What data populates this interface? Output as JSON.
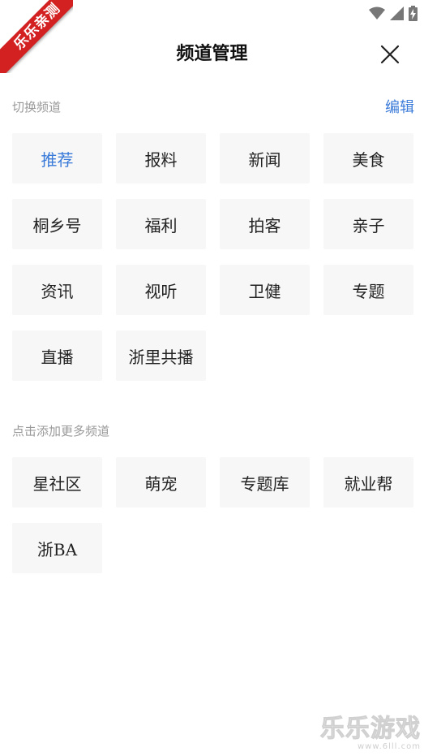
{
  "status_bar": {
    "icons": [
      "wifi-icon",
      "signal-icon",
      "battery-charging-icon"
    ]
  },
  "ribbon": {
    "text": "乐乐亲测"
  },
  "header": {
    "title": "频道管理",
    "close_icon": "close-icon"
  },
  "my_channels": {
    "title": "切换频道",
    "edit_label": "编辑",
    "items": [
      "推荐",
      "报料",
      "新闻",
      "美食",
      "桐乡号",
      "福利",
      "拍客",
      "亲子",
      "资讯",
      "视听",
      "卫健",
      "专题",
      "直播",
      "浙里共播"
    ],
    "active_index": 0
  },
  "more_channels": {
    "title": "点击添加更多频道",
    "items": [
      "星社区",
      "萌宠",
      "专题库",
      "就业帮",
      "浙BA"
    ]
  },
  "watermark": {
    "main": "乐乐游戏",
    "sub": "www.6lll.com"
  },
  "colors": {
    "accent": "#3a7ad9",
    "chip_bg": "#f7f7f7",
    "ribbon": "#d32020"
  }
}
